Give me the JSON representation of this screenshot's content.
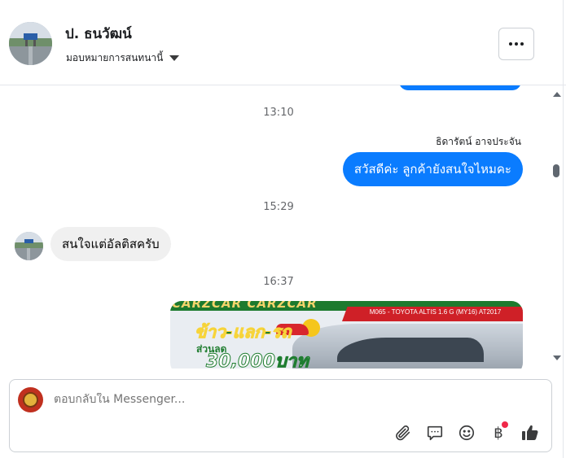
{
  "header": {
    "contact_name": "ป. ธนวัฒน์",
    "assign_label": "มอบหมายการสนทนานี้",
    "more_icon": "more-horizontal-icon"
  },
  "thread": {
    "timestamps": [
      "13:10",
      "15:29",
      "16:37"
    ],
    "outgoing": {
      "sender": "ธิดารัตน์ อาจประจัน",
      "text": "สวัสดีค่ะ ลูกค้ายังสนใจไหมคะ"
    },
    "incoming": {
      "text": "สนใจแต่อัลติสครับ"
    },
    "promo_image": {
      "brand": "CARZCAR CARZCAR",
      "model_line": "M065 - TOYOTA ALTIS 1.6 G (MY16) AT2017",
      "headline": "ข้าว-แลก-รถ",
      "discount_label": "ส่วนลด",
      "discount_amount": "30,000บาท"
    }
  },
  "composer": {
    "placeholder": "ตอบกลับใน Messenger...",
    "icons": [
      "attach-icon",
      "saved-replies-icon",
      "emoji-icon",
      "payment-baht-icon",
      "like-icon"
    ],
    "baht_symbol": "฿"
  },
  "colors": {
    "outgoing_bubble": "#0a7cff",
    "incoming_bubble": "#f0f0f0",
    "notification_dot": "#f02849"
  }
}
